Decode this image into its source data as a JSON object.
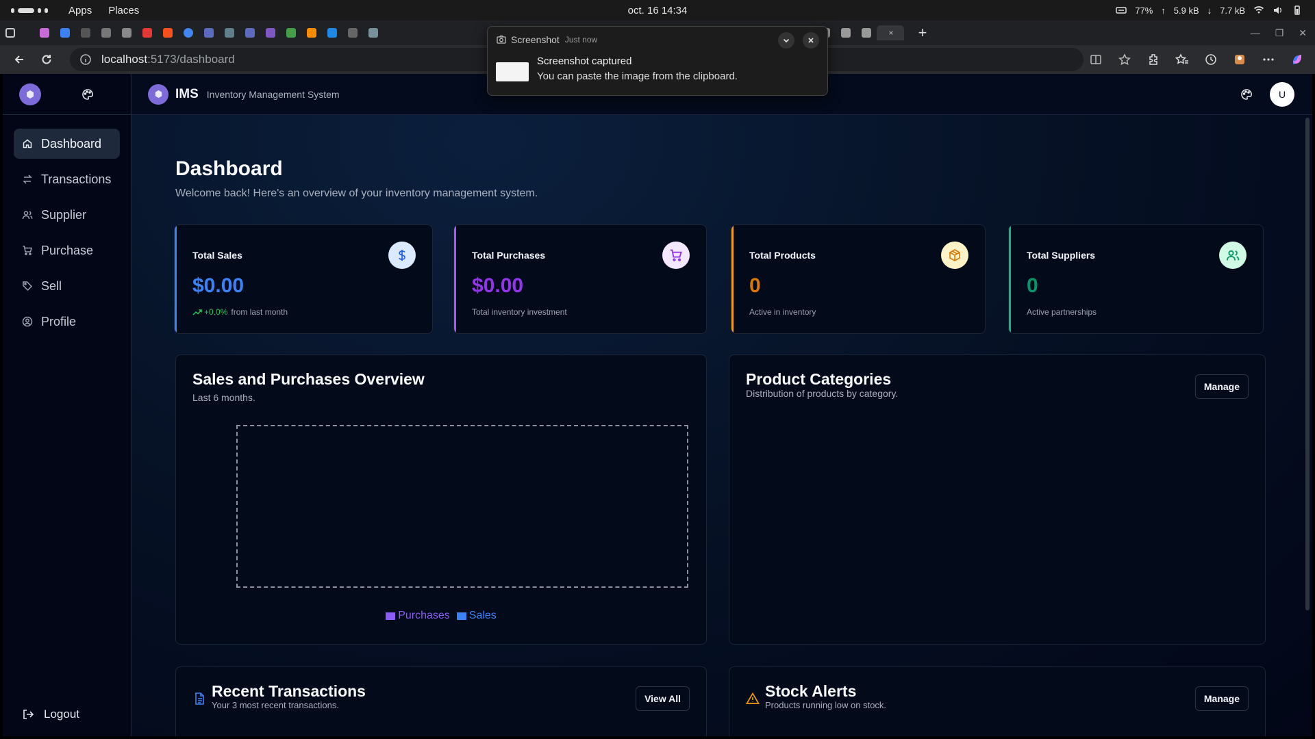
{
  "os": {
    "apps_label": "Apps",
    "places_label": "Places",
    "clock": "oct. 16  14:34",
    "battery": "77%",
    "upload": "5.9 kB",
    "download": "7.7 kB"
  },
  "browser": {
    "url_host": "localhost",
    "url_path": ":5173/dashboard"
  },
  "notification": {
    "app": "Screenshot",
    "time": "Just now",
    "title": "Screenshot captured",
    "body": "You can paste the image from the clipboard."
  },
  "app": {
    "brand": "IMS",
    "brand_subtitle": "Inventory Management System",
    "avatar_initial": "U",
    "accent": "#7c6bd8"
  },
  "sidebar": {
    "items": [
      {
        "label": "Dashboard",
        "icon": "home-icon",
        "active": true
      },
      {
        "label": "Transactions",
        "icon": "arrows-icon"
      },
      {
        "label": "Supplier",
        "icon": "users-icon"
      },
      {
        "label": "Purchase",
        "icon": "cart-icon"
      },
      {
        "label": "Sell",
        "icon": "tag-icon"
      },
      {
        "label": "Profile",
        "icon": "user-circle-icon"
      }
    ],
    "logout": "Logout"
  },
  "page": {
    "title": "Dashboard",
    "subtitle": "Welcome back! Here's an overview of your inventory management system."
  },
  "stats": [
    {
      "label": "Total Sales",
      "value": "$0.00",
      "trend": "+0.0%",
      "note": "from last month",
      "color": "#3b82f6",
      "icon": "dollar-icon"
    },
    {
      "label": "Total Purchases",
      "value": "$0.00",
      "note": "Total inventory investment",
      "color": "#a855f7",
      "icon": "cart-icon"
    },
    {
      "label": "Total Products",
      "value": "0",
      "note": "Active in inventory",
      "color": "#f59e0b",
      "icon": "box-icon"
    },
    {
      "label": "Total Suppliers",
      "value": "0",
      "note": "Active partnerships",
      "color": "#10b981",
      "icon": "users-icon"
    }
  ],
  "sales_chart": {
    "title": "Sales and Purchases Overview",
    "subtitle": "Last 6 months.",
    "legend": [
      {
        "label": "Purchases",
        "color": "#8b5cf6"
      },
      {
        "label": "Sales",
        "color": "#3b82f6"
      }
    ]
  },
  "categories": {
    "title": "Product Categories",
    "subtitle": "Distribution of products by category.",
    "button": "Manage"
  },
  "recent": {
    "title": "Recent Transactions",
    "subtitle": "Your 3 most recent transactions.",
    "button": "View All"
  },
  "alerts": {
    "title": "Stock Alerts",
    "subtitle": "Products running low on stock.",
    "button": "Manage"
  }
}
